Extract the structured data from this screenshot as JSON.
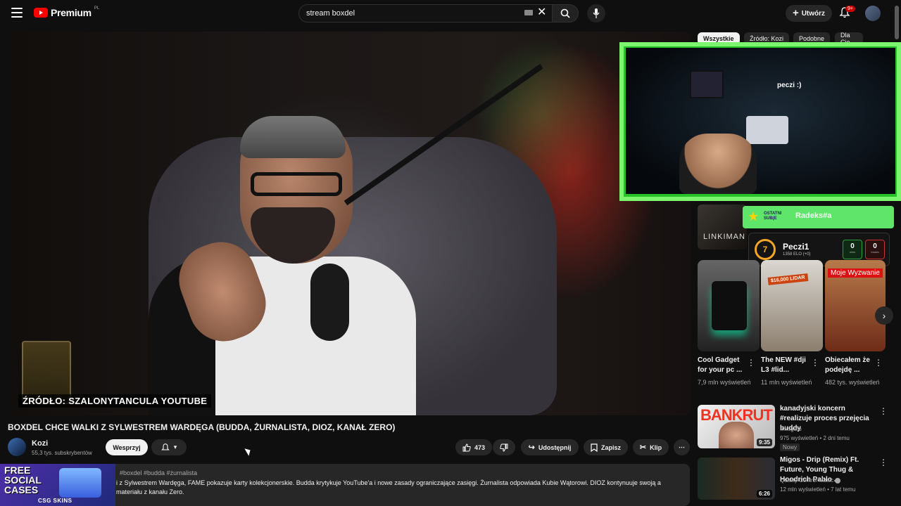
{
  "header": {
    "logo_text": "Premium",
    "logo_sup": "PL",
    "search_value": "stream boxdel",
    "create_label": "Utwórz",
    "notification_count": "9+"
  },
  "chips": [
    "Wszystkie",
    "Źródło: Kozi",
    "Podobne",
    "Dla Cie"
  ],
  "video": {
    "source_caption": "ŹRÓDŁO: SZALONYTANCULA YOUTUBE",
    "title": "BOXDEL CHCE WALKI Z SYLWESTREM WARDĘGA (BUDDA, ŻURNALISTA, DIOZ, KANAŁ ZERO)"
  },
  "channel": {
    "name": "Kozi",
    "subscribers": "55,3 tys. subskrybentów",
    "subscribe_label": "Wesprzyj"
  },
  "actions": {
    "likes": "473",
    "share": "Udostępnij",
    "save": "Zapisz",
    "clip": "Klip"
  },
  "description": {
    "hashtags": "#boxdel #budda #żurnalista",
    "text": "i z Sylwestrem Wardęga, FAME pokazuje karty kolekcjonerskie. Budda krytykuje YouTube'a i nowe zasady ograniczające zasięgi. Żurnalista odpowiada Kubie Wątorowi. DIOZ kontynuuje swoją a materiału z kanału Zero.",
    "promo_title": "FREE SOCIAL CASES",
    "promo_brand": "CSG SKINS"
  },
  "overlay": {
    "stream_text": "peczi :)",
    "sub_label": "OSTATNI SUB(E",
    "sub_name": "Radeks#a",
    "elo_level": "7",
    "elo_name": "Peczi1",
    "elo_score": "1358 ELO (+0)",
    "wins": "0",
    "wins_label": "wins",
    "losses": "0",
    "losses_label": "losses",
    "thumb_text": "LINKIMAN"
  },
  "shorts": [
    {
      "title": "Cool Gadget for your pc ...",
      "views": "7,9 mln wyświetleń"
    },
    {
      "title": "The NEW #dji L3 #lid...",
      "views": "11 mln wyświetleń",
      "tag": "$16,000 LIDAR"
    },
    {
      "title": "Obiecałem że podejdę ...",
      "views": "482 tys. wyświetleń",
      "tag": "Moje Wyzwanie"
    }
  ],
  "related": [
    {
      "title": "kanadyjski koncern #realizuje proces przejęcia buddy",
      "channel": "Inkoguto",
      "meta": "975 wyświetleń • 2 dni temu",
      "badge": "Nowy",
      "duration": "9:35",
      "thumb_text": "BANKRUT"
    },
    {
      "title": "Migos - Drip (Remix) Ft. Future, Young Thug & Hoodrich Pablo ...",
      "channel": "Quality Control Music",
      "meta": "12 mln wyświetleń • 7 lat temu",
      "duration": "6:26"
    }
  ]
}
